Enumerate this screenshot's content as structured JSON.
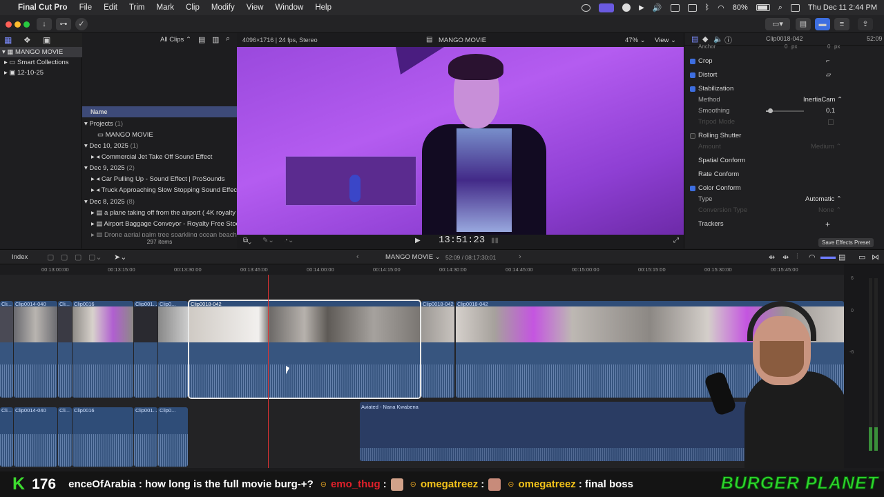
{
  "menubar": {
    "app_name": "Final Cut Pro",
    "items": [
      "File",
      "Edit",
      "Trim",
      "Mark",
      "Clip",
      "Modify",
      "View",
      "Window",
      "Help"
    ],
    "battery": "80%",
    "datetime": "Thu Dec 11  2:44 PM"
  },
  "library": {
    "items": [
      "MANGO MOVIE",
      "Smart Collections",
      "12-10-25"
    ]
  },
  "browser": {
    "filter": "All Clips",
    "column_name": "Name",
    "groups": [
      {
        "title": "Projects",
        "count": "(1)"
      },
      {
        "title": "Dec 10, 2025",
        "count": "(1)"
      },
      {
        "title": "Dec 9, 2025",
        "count": "(2)"
      },
      {
        "title": "Dec 8, 2025",
        "count": "(8)"
      }
    ],
    "items": [
      "MANGO MOVIE",
      "Commercial Jet Take Off Sound Effect",
      "Car Pulling Up - Sound Effect  |  ProSounds",
      "Truck Approaching Slow Stopping Sound Effect",
      "a plane taking off from the airport ( 4K royalty",
      "Airport Baggage Conveyor - Royalty Free Stoc",
      "Drone aerial palm tree sparkling ocean beach"
    ],
    "item_count": "297 items"
  },
  "viewer": {
    "format": "4096×1716 | 24 fps, Stereo",
    "project_name": "MANGO MOVIE",
    "zoom": "47%",
    "view_label": "View",
    "timecode": "13:51:23"
  },
  "inspector": {
    "clip_name": "Clip0018-042",
    "duration": "52:09",
    "anchor_label": "Anchor",
    "anchor_x": "0",
    "anchor_y": "0",
    "unit": "px",
    "sections": {
      "crop": "Crop",
      "distort": "Distort",
      "stabilization": "Stabilization",
      "method_label": "Method",
      "method_value": "InertiaCam",
      "smoothing_label": "Smoothing",
      "smoothing_value": "0.1",
      "smoothing_level": 0.1,
      "tripod_label": "Tripod Mode",
      "rolling_shutter": "Rolling Shutter",
      "amount_label": "Amount",
      "amount_value": "Medium",
      "spatial_conform": "Spatial Conform",
      "rate_conform": "Rate Conform",
      "color_conform": "Color Conform",
      "type_label": "Type",
      "type_value": "Automatic",
      "conversion_label": "Conversion Type",
      "conversion_value": "None",
      "trackers": "Trackers"
    },
    "save_preset": "Save Effects Preset"
  },
  "timeline": {
    "index_label": "Index",
    "project_name": "MANGO MOVIE",
    "position": "52:09 / 08:17:30:01",
    "ruler": [
      "00:13:00:00",
      "00:13:15:00",
      "00:13:30:00",
      "00:13:45:00",
      "00:14:00:00",
      "00:14:15:00",
      "00:14:30:00",
      "00:14:45:00",
      "00:15:00:00",
      "00:15:15:00",
      "00:15:30:00",
      "00:15:45:00"
    ],
    "clips_top": [
      "Cli...",
      "Clip0014-040",
      "Cli...",
      "Clip0016",
      "Clip001...",
      "Clip0...",
      "Clip0018-042",
      "Clip0018-042",
      "Clip0018-042"
    ],
    "clips_bottom": [
      "Cli...",
      "Clip0014-040",
      "Cli...",
      "Clip0016",
      "Clip001...",
      "Clip0..."
    ],
    "music_clip": "Aviated - Nana Kwabena"
  },
  "overlay": {
    "counter": "176",
    "chat_text": "enceOfArabia : how long is the full movie burg-+?",
    "user1": "emo_thug",
    "user2": "omegatreez",
    "user3": "omegatreez",
    "msg3": ": final boss",
    "brand": "BURGER PLANET",
    "colors": {
      "counter": "#3ddc2f",
      "user_red": "#e0202a",
      "user_yellow": "#f2c21a",
      "brand": "#2dd42d"
    }
  }
}
